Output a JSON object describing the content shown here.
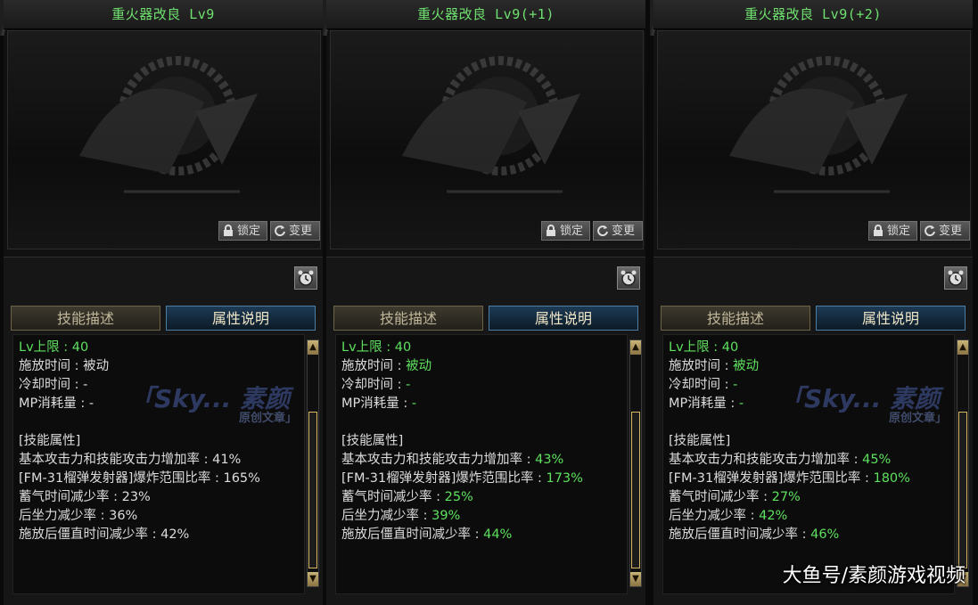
{
  "panels": [
    {
      "title": "重火器改良 Lv9",
      "lock_label": "锁定",
      "change_label": "变更",
      "tabs": {
        "desc": "技能描述",
        "attr": "属性说明"
      },
      "lines": {
        "lv_label": "Lv上限",
        "lv_value": "40",
        "cast_label": "施放时间",
        "cast_value": "被动",
        "cooldown_label": "冷却时间",
        "cooldown_value": "-",
        "mp_label": "MP消耗量",
        "mp_value": "-",
        "section": "[技能属性]",
        "atk_label": "基本攻击力和技能攻击力增加率",
        "atk_value": "41%",
        "blast_label": "[FM-31榴弹发射器]爆炸范围比率",
        "blast_value": "165%",
        "charge_label": "蓄气时间减少率",
        "charge_value": "23%",
        "recoil_label": "后坐力减少率",
        "recoil_value": "36%",
        "stiff_label": "施放后僵直时间减少率",
        "stiff_value": "42%"
      }
    },
    {
      "title": "重火器改良 Lv9(+1)",
      "lock_label": "锁定",
      "change_label": "变更",
      "tabs": {
        "desc": "技能描述",
        "attr": "属性说明"
      },
      "lines": {
        "lv_label": "Lv上限",
        "lv_value": "40",
        "cast_label": "施放时间",
        "cast_value": "被动",
        "cooldown_label": "冷却时间",
        "cooldown_value": "-",
        "mp_label": "MP消耗量",
        "mp_value": "-",
        "section": "[技能属性]",
        "atk_label": "基本攻击力和技能攻击力增加率",
        "atk_value": "43%",
        "blast_label": "[FM-31榴弹发射器]爆炸范围比率",
        "blast_value": "173%",
        "charge_label": "蓄气时间减少率",
        "charge_value": "25%",
        "recoil_label": "后坐力减少率",
        "recoil_value": "39%",
        "stiff_label": "施放后僵直时间减少率",
        "stiff_value": "44%"
      }
    },
    {
      "title": "重火器改良 Lv9(+2)",
      "lock_label": "锁定",
      "change_label": "变更",
      "tabs": {
        "desc": "技能描述",
        "attr": "属性说明"
      },
      "lines": {
        "lv_label": "Lv上限",
        "lv_value": "40",
        "cast_label": "施放时间",
        "cast_value": "被动",
        "cooldown_label": "冷却时间",
        "cooldown_value": "-",
        "mp_label": "MP消耗量",
        "mp_value": "-",
        "section": "[技能属性]",
        "atk_label": "基本攻击力和技能攻击力增加率",
        "atk_value": "45%",
        "blast_label": "[FM-31榴弹发射器]爆炸范围比率",
        "blast_value": "180%",
        "charge_label": "蓄气时间减少率",
        "charge_value": "27%",
        "recoil_label": "后坐力减少率",
        "recoil_value": "42%",
        "stiff_label": "施放后僵直时间减少率",
        "stiff_value": "46%"
      }
    }
  ],
  "watermark": {
    "main": "「Sky... 素颜",
    "sub": "原创文章」"
  },
  "credit": "大鱼号/素颜游戏视频",
  "colors": {
    "title_green": "#6fe06f",
    "value_green": "#5ee05e",
    "tab_active": "#4b7ea4",
    "scroll_gold": "#d8b860"
  }
}
